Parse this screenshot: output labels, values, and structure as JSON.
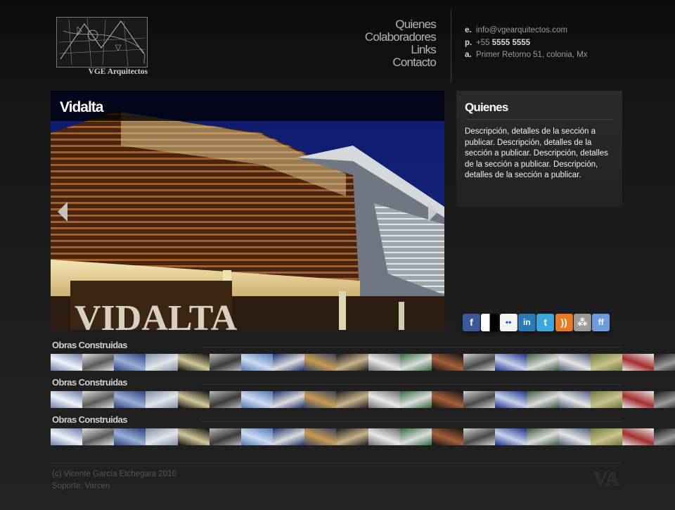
{
  "header": {
    "logo_text": "VGE Arquitectos",
    "nav": [
      "Quienes",
      "Colaboradores",
      "Links",
      "Contacto"
    ],
    "contact": {
      "email_key": "e.",
      "email": "info@vgearquitectos.com",
      "phone_key": "p.",
      "phone_prefix": "+55",
      "phone": "5555 5555",
      "address_key": "a.",
      "address": "Primer Retorno 51, colonia, Mx"
    }
  },
  "slideshow": {
    "title": "Vidalta",
    "sign_text": "VIDALTA",
    "prev_icon": "chevron-left-icon",
    "next_icon": "chevron-right-icon"
  },
  "info": {
    "title": "Quienes",
    "body": "Descripción, detalles de la sección a publicar. Descripción, detalles de la sección a publicar. Descripción, detalles de la sección a publicar. Descripción, detalles de la sección a publicar."
  },
  "social": [
    {
      "name": "facebook-icon",
      "glyph": "f",
      "color": "#3b5998"
    },
    {
      "name": "delicious-icon",
      "glyph": "",
      "color": "#ffffff"
    },
    {
      "name": "flickr-icon",
      "glyph": "••",
      "color": "#f4f4f4"
    },
    {
      "name": "linkedin-icon",
      "glyph": "in",
      "color": "#2a7bb5"
    },
    {
      "name": "twitter-icon",
      "glyph": "t",
      "color": "#38a8dd"
    },
    {
      "name": "rss-icon",
      "glyph": "))",
      "color": "#e87b21"
    },
    {
      "name": "myspace-icon",
      "glyph": "⁂",
      "color": "#9a9a9a"
    },
    {
      "name": "friendfeed-icon",
      "glyph": "ff",
      "color": "#6d9be0"
    }
  ],
  "galleries": [
    {
      "title": "Obras Construidas"
    },
    {
      "title": "Obras Construidas"
    },
    {
      "title": "Obras Construidas"
    }
  ],
  "thumb_colors": [
    [
      "#6a7ea8",
      "#eef2f8"
    ],
    [
      "#dcdcdc",
      "#5b5b5b"
    ],
    [
      "#2b3f7d",
      "#9ab0d6"
    ],
    [
      "#7f8fa6",
      "#e1e4ea"
    ],
    [
      "#0b0b0b",
      "#d0c89a"
    ],
    [
      "#b8b8b8",
      "#3c3c3c"
    ],
    [
      "#4d79b5",
      "#cfdaf0"
    ],
    [
      "#1c2f6e",
      "#dcdcdc"
    ],
    [
      "#384664",
      "#c79a52"
    ],
    [
      "#1d1d1d",
      "#c7b28a"
    ],
    [
      "#6e6e6e",
      "#e8e8e8"
    ],
    [
      "#2d6b3a",
      "#dcdcdc"
    ],
    [
      "#141414",
      "#a55f3a"
    ],
    [
      "#d0d0d0",
      "#4a4a4a"
    ],
    [
      "#1a2f8c",
      "#c8d2ea"
    ],
    [
      "#3a5a3a",
      "#dadada"
    ],
    [
      "#4c5c7a",
      "#e5e5e5"
    ],
    [
      "#6b7a3a",
      "#c9c28a"
    ],
    [
      "#e9e9e9",
      "#a33030"
    ],
    [
      "#141414",
      "#9a9a9a"
    ]
  ],
  "footer": {
    "copyright": "(c) Vicente García Etchegara 2010",
    "support": "Soporte: Varcen",
    "mark": "VA"
  }
}
